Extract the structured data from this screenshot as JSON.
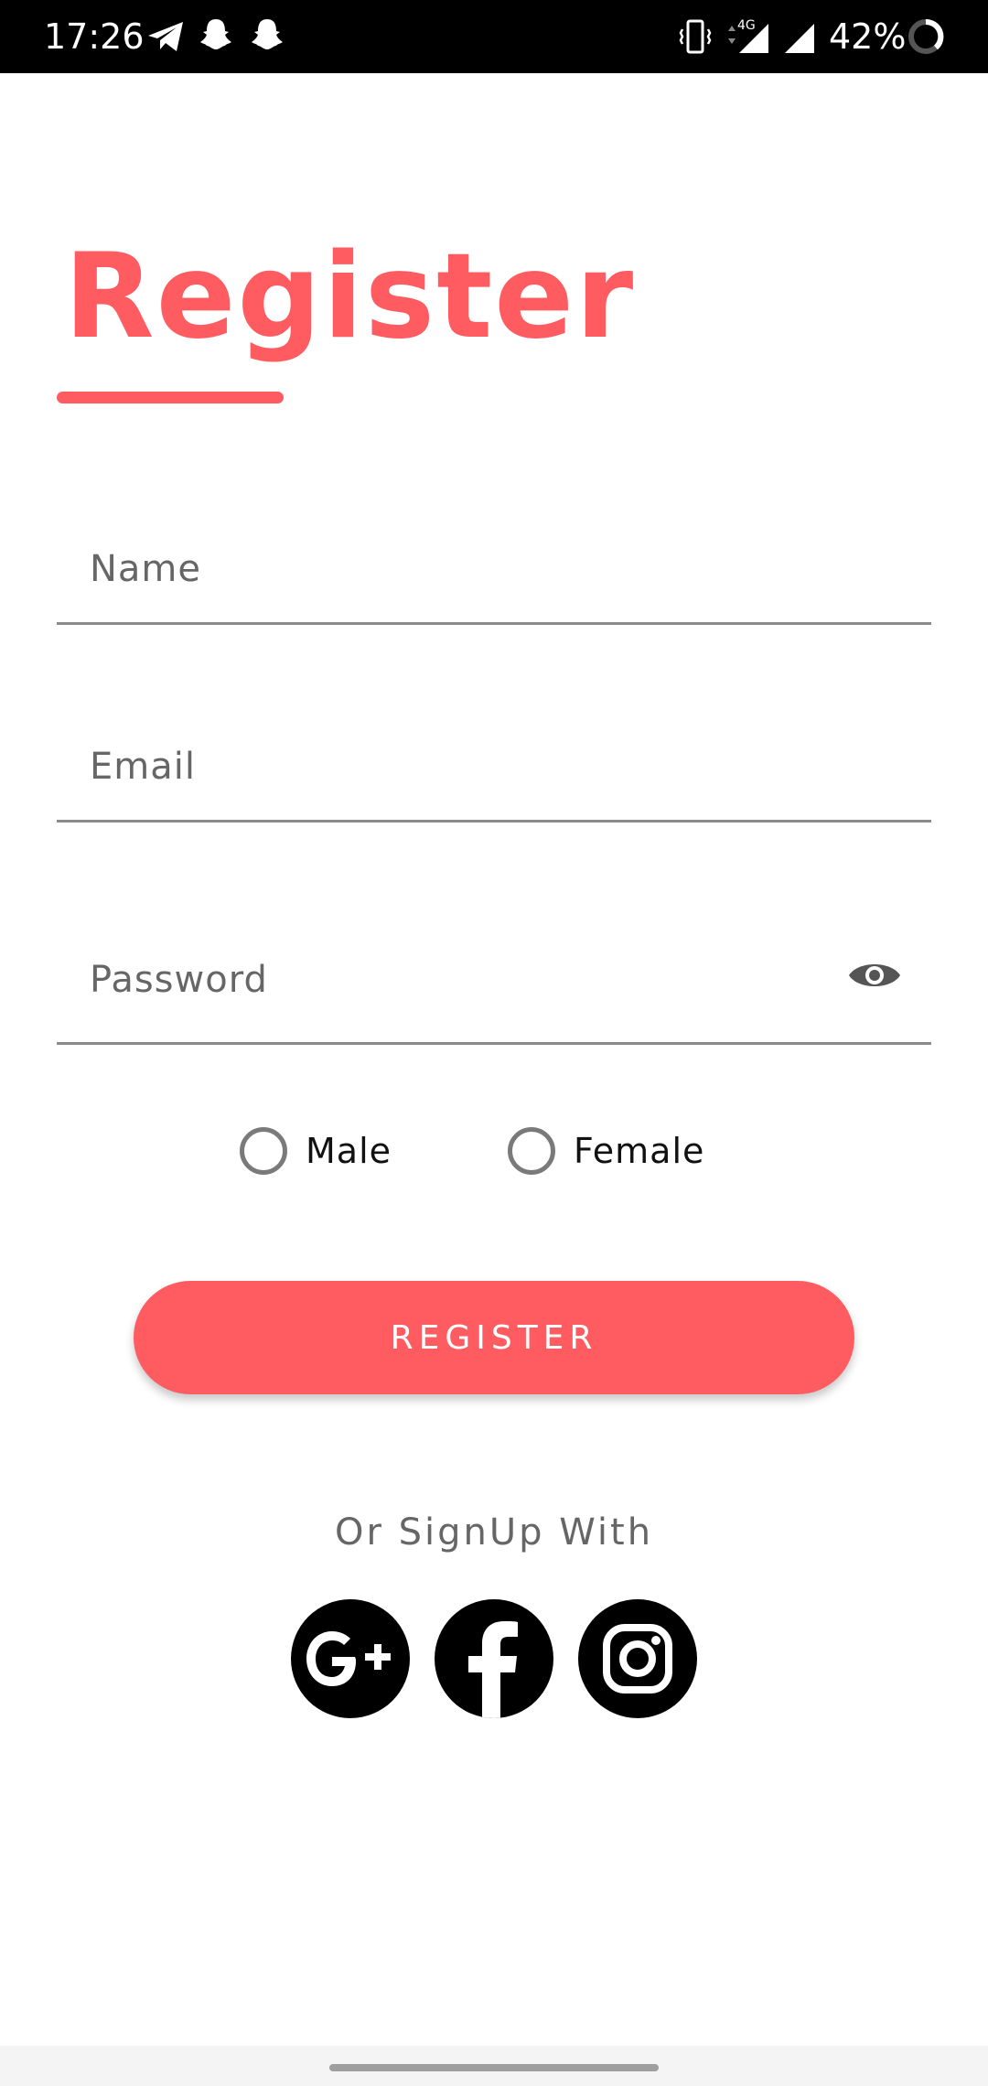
{
  "status_bar": {
    "time": "17:26",
    "network": "4G",
    "battery": "42%"
  },
  "title": "Register",
  "form": {
    "name_placeholder": "Name",
    "email_placeholder": "Email",
    "password_placeholder": "Password",
    "gender_options": [
      "Male",
      "Female"
    ],
    "register_label": "REGISTER"
  },
  "social": {
    "prompt": "Or SignUp With",
    "providers": [
      "google-plus-icon",
      "facebook-icon",
      "instagram-icon"
    ]
  },
  "colors": {
    "accent": "#ff5c61",
    "field_line": "#8a8a8a",
    "placeholder": "#666666"
  }
}
